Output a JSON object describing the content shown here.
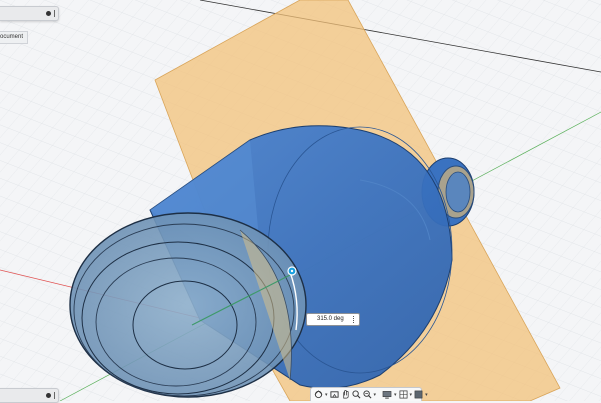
{
  "browser": {
    "document_label": "ocument"
  },
  "manipulator": {
    "angle_value": "315.0 deg"
  },
  "nav_toolbar": {
    "tools": [
      "orbit-icon",
      "look-at-icon",
      "pan-icon",
      "zoom-window-icon",
      "fit-icon",
      "display-settings-icon",
      "grid-settings-icon",
      "viewports-icon"
    ]
  },
  "colors": {
    "plane": "#f3c27a",
    "body": "#3a72c0",
    "end_cap": "#7e9fbf",
    "gizmo": "#1aa0e0"
  }
}
